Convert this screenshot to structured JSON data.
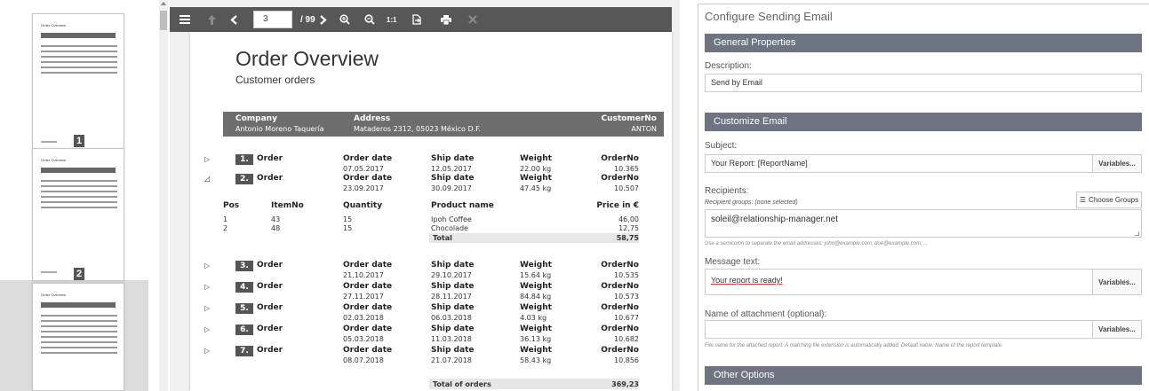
{
  "thumbnails": {
    "page_numbers": [
      "1",
      "2"
    ]
  },
  "toolbar": {
    "current_page": "3",
    "total_pages": "/ 99",
    "zoom_reset": "1:1"
  },
  "report": {
    "title": "Order Overview",
    "subtitle": "Customer orders",
    "customer_header": {
      "company_label": "Company",
      "company": "Antonio Moreno Taquería",
      "address_label": "Address",
      "address": "Mataderos 2312, 05023 México D.F.",
      "customerno_label": "CustomerNo",
      "customerno": "ANTON"
    },
    "orders": [
      {
        "num": "1.",
        "label": "Order",
        "order_date_label": "Order date",
        "order_date": "07.05.2017",
        "ship_date_label": "Ship date",
        "ship_date": "12.05.2017",
        "weight_label": "Weight",
        "weight": "22.00 kg",
        "orderno_label": "OrderNo",
        "orderno": "10.365"
      },
      {
        "num": "2.",
        "label": "Order",
        "order_date_label": "Order date",
        "order_date": "23.09.2017",
        "ship_date_label": "Ship date",
        "ship_date": "30.09.2017",
        "weight_label": "Weight",
        "weight": "47.45 kg",
        "orderno_label": "OrderNo",
        "orderno": "10.507"
      },
      {
        "num": "3.",
        "label": "Order",
        "order_date_label": "Order date",
        "order_date": "21.10.2017",
        "ship_date_label": "Ship date",
        "ship_date": "29.10.2017",
        "weight_label": "Weight",
        "weight": "15.64 kg",
        "orderno_label": "OrderNo",
        "orderno": "10.535"
      },
      {
        "num": "4.",
        "label": "Order",
        "order_date_label": "Order date",
        "order_date": "27.11.2017",
        "ship_date_label": "Ship date",
        "ship_date": "28.11.2017",
        "weight_label": "Weight",
        "weight": "84.84 kg",
        "orderno_label": "OrderNo",
        "orderno": "10.573"
      },
      {
        "num": "5.",
        "label": "Order",
        "order_date_label": "Order date",
        "order_date": "02.03.2018",
        "ship_date_label": "Ship date",
        "ship_date": "06.03.2018",
        "weight_label": "Weight",
        "weight": "4.03 kg",
        "orderno_label": "OrderNo",
        "orderno": "10.677"
      },
      {
        "num": "6.",
        "label": "Order",
        "order_date_label": "Order date",
        "order_date": "05.03.2018",
        "ship_date_label": "Ship date",
        "ship_date": "11.03.2018",
        "weight_label": "Weight",
        "weight": "36.13 kg",
        "orderno_label": "OrderNo",
        "orderno": "10.682"
      },
      {
        "num": "7.",
        "label": "Order",
        "order_date_label": "Order date",
        "order_date": "08.07.2018",
        "ship_date_label": "Ship date",
        "ship_date": "21.07.2018",
        "weight_label": "Weight",
        "weight": "58.43 kg",
        "orderno_label": "OrderNo",
        "orderno": "10.856"
      }
    ],
    "items_table": {
      "headers": [
        "Pos",
        "ItemNo",
        "Quantity",
        "Product name",
        "Price in €"
      ],
      "rows": [
        [
          "1",
          "43",
          "15",
          "Ipoh Coffee",
          "46,00"
        ],
        [
          "2",
          "48",
          "15",
          "Chocolade",
          "12,75"
        ]
      ],
      "total_label": "Total",
      "total_value": "58,75"
    },
    "grand_total_label": "Total of orders",
    "grand_total_value": "369,23"
  },
  "config": {
    "title": "Configure Sending Email",
    "general_section": "General Properties",
    "description_label": "Description:",
    "description_value": "Send by Email",
    "customize_section": "Customize Email",
    "subject_label": "Subject:",
    "subject_value": "Your Report: [ReportName]",
    "variables_button": "Variables...",
    "recipients_label": "Recipients:",
    "recipient_groups": "Recipient groups: (none selected)",
    "choose_groups_button": "Choose Groups",
    "recipients_value": "soleil@relationship-manager.net",
    "recipients_hint": "Use a semicolon to separate the email addresses: john@example.com; doe@example.com; ...",
    "message_label": "Message text:",
    "message_value": "Your report is ready!",
    "attachment_label": "Name of attachment (optional):",
    "attachment_value": "",
    "attachment_hint": "File name for the attached report. A matching file extension is automatically added. Default value: Name of the report template.",
    "other_section": "Other Options"
  }
}
